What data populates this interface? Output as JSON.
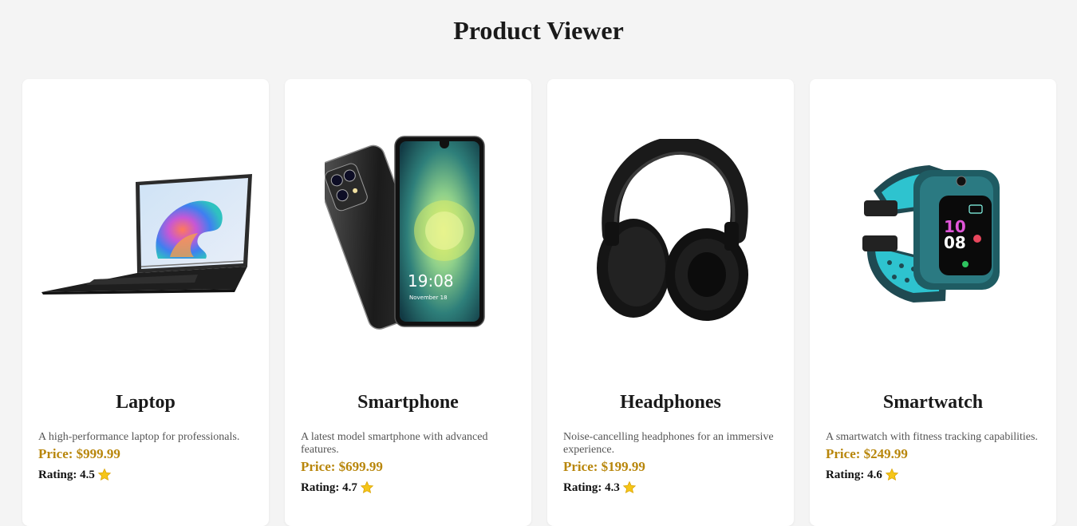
{
  "page": {
    "title": "Product Viewer"
  },
  "products": [
    {
      "name": "Laptop",
      "description": "A high-performance laptop for professionals.",
      "price": "Price: $999.99",
      "rating_label": "Rating: 4.5",
      "rating": 4.5,
      "image_icon": "laptop-image"
    },
    {
      "name": "Smartphone",
      "description": "A latest model smartphone with advanced features.",
      "price": "Price: $699.99",
      "rating_label": "Rating: 4.7",
      "rating": 4.7,
      "image_icon": "smartphone-image",
      "screen_time": "19:08",
      "screen_date": "November 18"
    },
    {
      "name": "Headphones",
      "description": "Noise-cancelling headphones for an immersive experience.",
      "price": "Price: $199.99",
      "rating_label": "Rating: 4.3",
      "rating": 4.3,
      "image_icon": "headphones-image"
    },
    {
      "name": "Smartwatch",
      "description": "A smartwatch with fitness tracking capabilities.",
      "price": "Price: $249.99",
      "rating_label": "Rating: 4.6",
      "rating": 4.6,
      "image_icon": "smartwatch-image",
      "screen_hour": "10",
      "screen_minute": "08"
    }
  ],
  "colors": {
    "background": "#f4f4f4",
    "card": "#ffffff",
    "price": "#b8860b",
    "star": "#f5c518"
  }
}
